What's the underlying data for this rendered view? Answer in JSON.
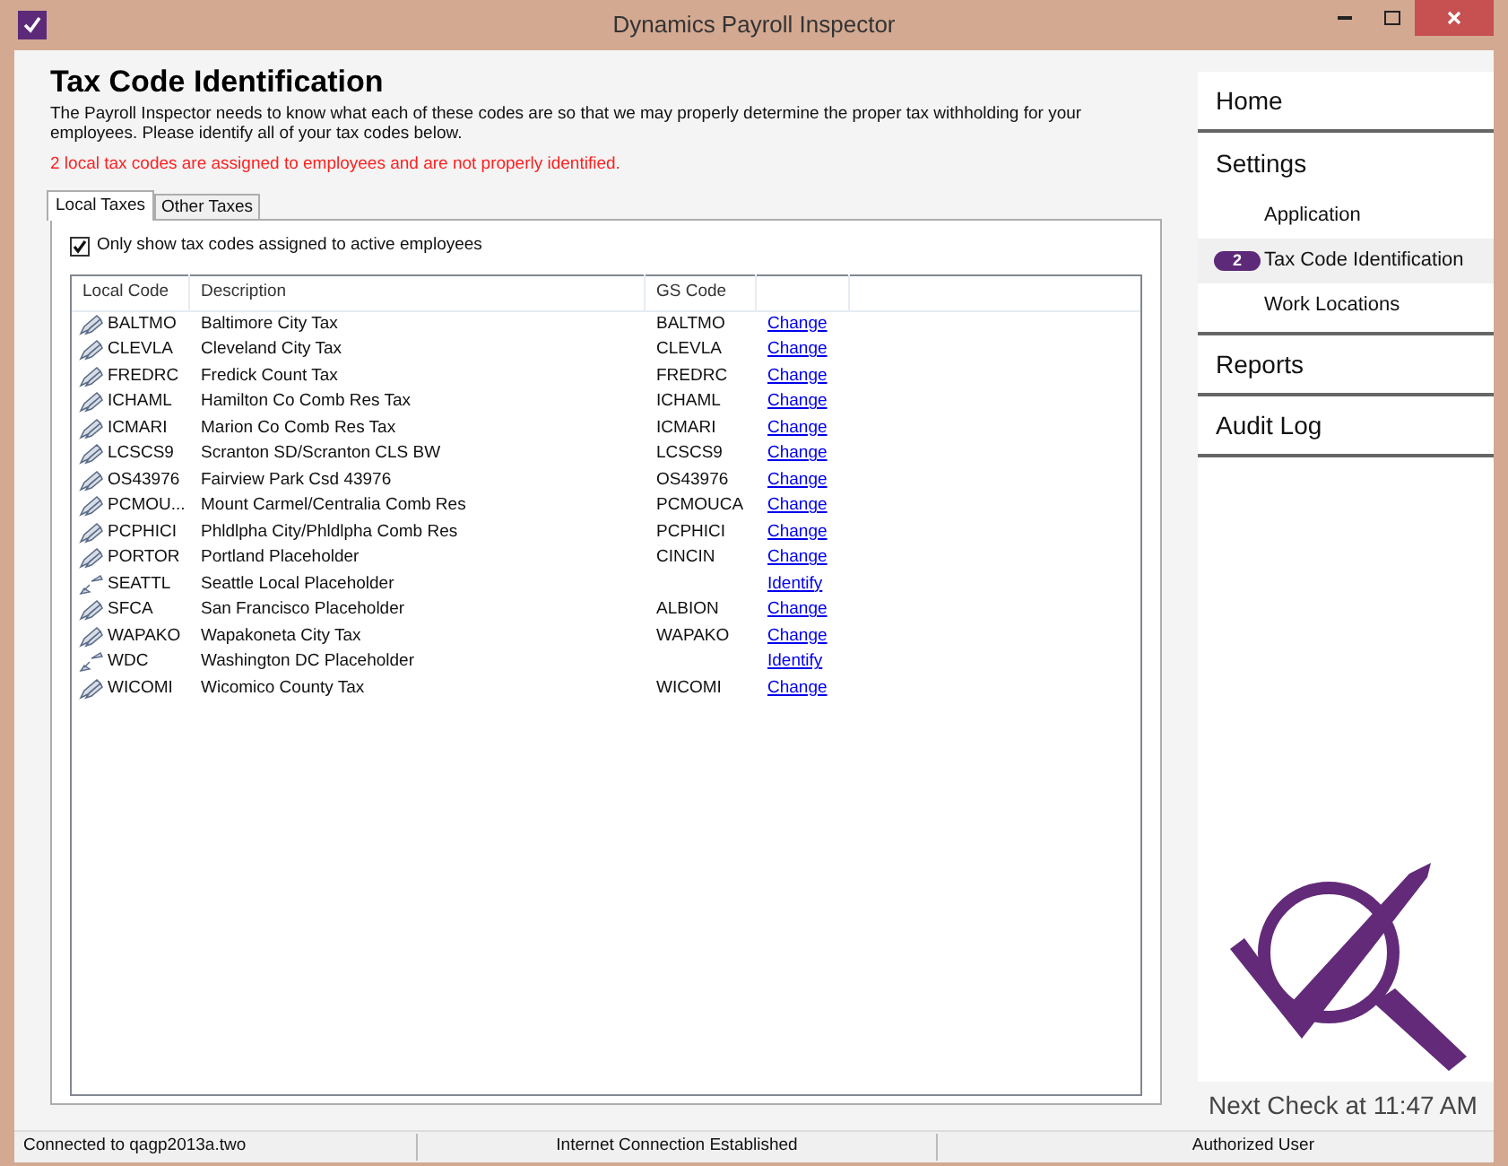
{
  "window": {
    "title": "Dynamics Payroll Inspector"
  },
  "page": {
    "title": "Tax Code Identification",
    "intro": "The Payroll Inspector needs to know what each of these codes are so that we may properly determine the proper tax withholding for your employees. Please identify all of your tax codes below.",
    "warning": "2 local tax codes are assigned to employees and are not properly identified."
  },
  "tabs": [
    {
      "label": "Local Taxes",
      "selected": true
    },
    {
      "label": "Other Taxes",
      "selected": false
    }
  ],
  "filter": {
    "label": "Only show tax codes assigned to active employees",
    "checked": true
  },
  "table": {
    "columns": [
      "Local Code",
      "Description",
      "GS Code"
    ],
    "rows": [
      {
        "kind": "identified",
        "local_code": "BALTMO",
        "description": "Baltimore City Tax",
        "gs_code": "BALTMO",
        "action": "Change"
      },
      {
        "kind": "identified",
        "local_code": "CLEVLA",
        "description": "Cleveland City Tax",
        "gs_code": "CLEVLA",
        "action": "Change"
      },
      {
        "kind": "identified",
        "local_code": "FREDRC",
        "description": "Fredick Count Tax",
        "gs_code": "FREDRC",
        "action": "Change"
      },
      {
        "kind": "identified",
        "local_code": "ICHAML",
        "description": "Hamilton Co Comb Res Tax",
        "gs_code": "ICHAML",
        "action": "Change"
      },
      {
        "kind": "identified",
        "local_code": "ICMARI",
        "description": "Marion Co Comb Res Tax",
        "gs_code": "ICMARI",
        "action": "Change"
      },
      {
        "kind": "identified",
        "local_code": "LCSCS9",
        "description": "Scranton SD/Scranton CLS BW",
        "gs_code": "LCSCS9",
        "action": "Change"
      },
      {
        "kind": "identified",
        "local_code": "OS43976",
        "description": "Fairview Park Csd 43976",
        "gs_code": "OS43976",
        "action": "Change"
      },
      {
        "kind": "identified",
        "local_code": "PCMOU...",
        "description": "Mount Carmel/Centralia Comb Res",
        "gs_code": "PCMOUCA",
        "action": "Change"
      },
      {
        "kind": "identified",
        "local_code": "PCPHICI",
        "description": "Phldlpha City/Phldlpha Comb Res",
        "gs_code": "PCPHICI",
        "action": "Change"
      },
      {
        "kind": "identified",
        "local_code": "PORTOR",
        "description": "Portland Placeholder",
        "gs_code": "CINCIN",
        "action": "Change"
      },
      {
        "kind": "unidentified",
        "local_code": "SEATTL",
        "description": "Seattle Local Placeholder",
        "action": "Identify"
      },
      {
        "kind": "identified",
        "local_code": "SFCA",
        "description": "San Francisco Placeholder",
        "gs_code": "ALBION",
        "action": "Change"
      },
      {
        "kind": "identified",
        "local_code": "WAPAKO",
        "description": "Wapakoneta City Tax",
        "gs_code": "WAPAKO",
        "action": "Change"
      },
      {
        "kind": "unidentified",
        "local_code": "WDC",
        "description": "Washington DC Placeholder",
        "action": "Identify"
      },
      {
        "kind": "identified",
        "local_code": "WICOMI",
        "description": "Wicomico County Tax",
        "gs_code": "WICOMI",
        "action": "Change"
      }
    ]
  },
  "sidebar": {
    "items": [
      {
        "label": "Home",
        "selected": false
      },
      {
        "label": "Settings",
        "selected": false,
        "children": [
          {
            "label": "Application",
            "selected": false
          },
          {
            "label": "Tax Code Identification",
            "selected": true,
            "badge": "2"
          },
          {
            "label": "Work Locations",
            "selected": false
          }
        ]
      },
      {
        "label": "Reports",
        "selected": false
      },
      {
        "label": "Audit Log",
        "selected": false
      }
    ]
  },
  "next_check": "Next Check at 11:47 AM",
  "status_bar": [
    "Connected to qagp2013a.two",
    "Internet Connection Established",
    "Authorized User"
  ]
}
